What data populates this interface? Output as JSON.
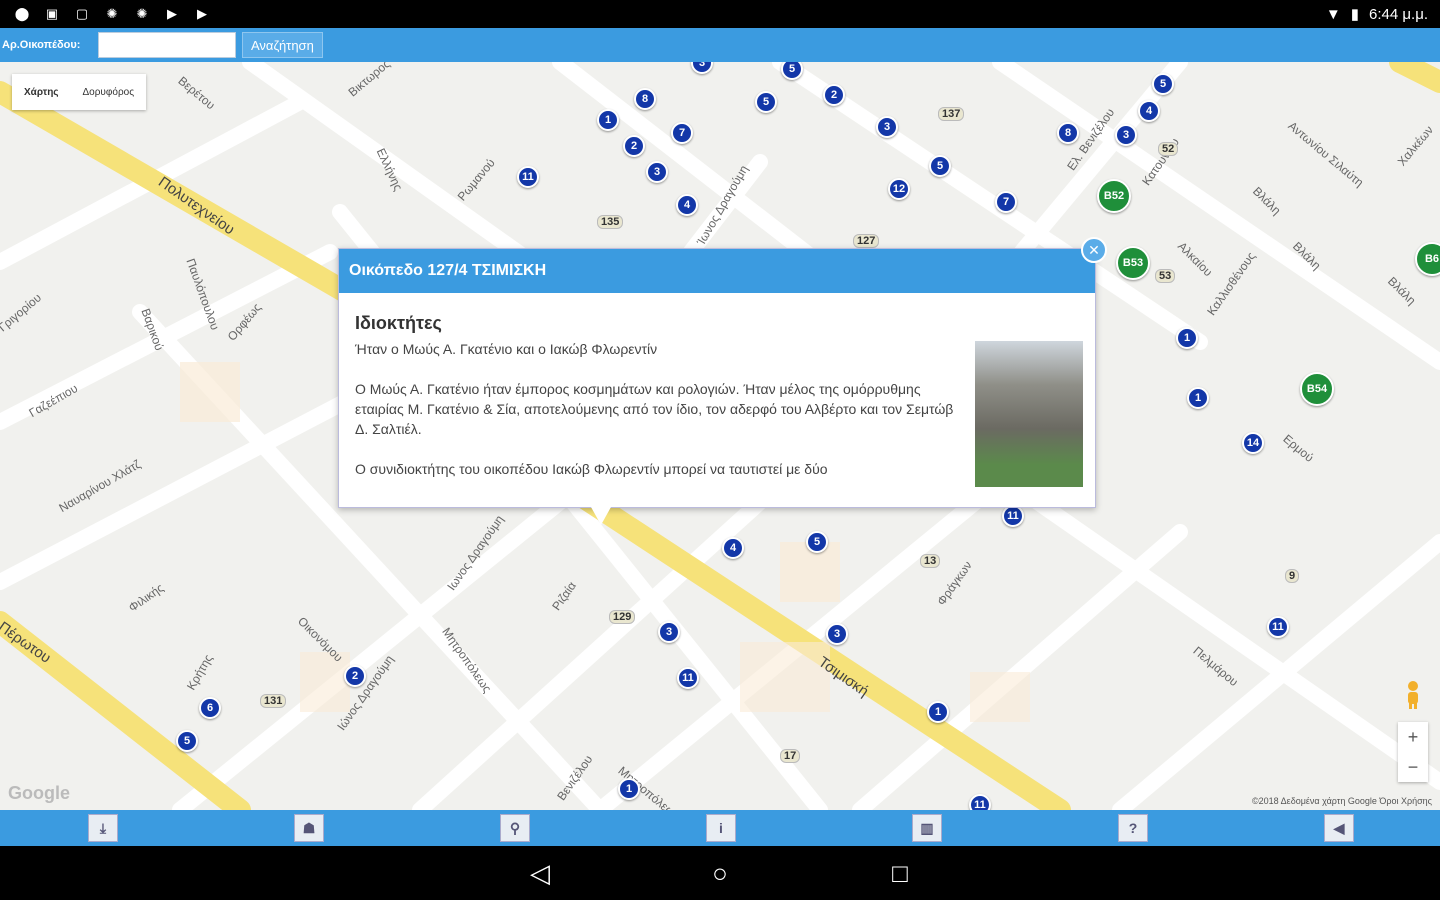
{
  "status_bar": {
    "time": "6:44 μ.μ.",
    "left_icons": [
      "location-icon",
      "gallery-icon",
      "image-icon",
      "sync-icon",
      "sync2-icon",
      "play-store-icon",
      "play-icon"
    ],
    "right_icons": [
      "wifi-icon",
      "battery-icon"
    ]
  },
  "search": {
    "label": "Αρ.Οικοπέδου:",
    "value": "",
    "button_label": "Αναζήτηση"
  },
  "map": {
    "map_type": {
      "map": "Χάρτης",
      "satellite": "Δορυφόρος"
    },
    "streets": [
      "Πολυτεχνείου",
      "Παυλόπουλου",
      "Βερέτου",
      "Ορφέως",
      "Βικτωρος",
      "Ελλήνης",
      "Ίωνος Δραγούμη",
      "Ιωνος Δραγούμη",
      "Ιώνος Δραγούμη",
      "Ελ. Βενιζέλου",
      "Βενιζέλου",
      "Τσιμισκή",
      "Μητροπόλεως",
      "Μητροπόλεως",
      "Κρήτης",
      "Φιλικής",
      "Φράγκων",
      "Αντωνίου Σιλαύτη",
      "Χαλκέων",
      "Βλάλη",
      "Βλάλη",
      "Βλάλη",
      "Καλλισθένους",
      "Ερμού",
      "Αλκαίου",
      "Κατουνίου",
      "Ριζαία",
      "Πελμάρου",
      "Ρωμανού",
      "Βαρικού",
      "Ναυαρίνου Χλάτζ",
      "Γαζεέπιου",
      "Πέρωτου",
      "Οικονόμου",
      "Γριγορίου"
    ],
    "markers_blue": [
      "8",
      "1",
      "2",
      "3",
      "7",
      "4",
      "5",
      "5",
      "2",
      "3",
      "5",
      "7",
      "8",
      "3",
      "4",
      "5",
      "11",
      "1",
      "1",
      "14",
      "11",
      "4",
      "5",
      "11",
      "3",
      "3",
      "2",
      "6",
      "5",
      "11",
      "1",
      "1",
      "12",
      "11",
      "3"
    ],
    "markers_green": [
      "B52",
      "B53",
      "B54",
      "B6"
    ],
    "number_labels": [
      "137",
      "52",
      "53",
      "135",
      "129",
      "131",
      "17",
      "13",
      "127",
      "9"
    ],
    "attribution": "Google",
    "copyright": "©2018 Δεδομένα χάρτη Google   Όροι Χρήσης",
    "zoom_in": "+",
    "zoom_out": "−"
  },
  "info_window": {
    "title": "Οικόπεδο 127/4 ΤΣΙΜΙΣΚΗ",
    "heading": "Ιδιοκτήτες",
    "paragraphs": [
      "Ήταν ο Μωύς Α. Γκατένιο και ο Ιακώβ Φλωρεντίν",
      "Ο Μωύς Α. Γκατένιο ήταν έμπορος κοσμημάτων και ρολογιών. Ήταν μέλος της ομόρρυθμης εταιρίας Μ. Γκατένιο & Σία, αποτελούμενης από τον ίδιο, τον αδερφό του Αλβέρτο και τον Σεμτώβ Δ. Σαλτιέλ.",
      "Ο συνιδιοκτήτης του οικοπέδου Ιακώβ Φλωρεντίν μπορεί να ταυτιστεί με δύο"
    ],
    "close_icon": "close-icon"
  },
  "bottom_toolbar": {
    "buttons": [
      {
        "name": "download-button",
        "icon": "download-icon",
        "glyph": "⤓"
      },
      {
        "name": "user-location-button",
        "icon": "person-icon",
        "glyph": "☗"
      },
      {
        "name": "place-button",
        "icon": "pin-icon",
        "glyph": "⚲"
      },
      {
        "name": "info-button",
        "icon": "info-icon",
        "glyph": "i"
      },
      {
        "name": "layers-button",
        "icon": "book-icon",
        "glyph": "▥"
      },
      {
        "name": "help-button",
        "icon": "question-icon",
        "glyph": "?"
      },
      {
        "name": "back-button",
        "icon": "back-arrow-icon",
        "glyph": "◀"
      }
    ]
  },
  "nav_bar": {
    "back": "◁",
    "home": "○",
    "recents": "□"
  }
}
